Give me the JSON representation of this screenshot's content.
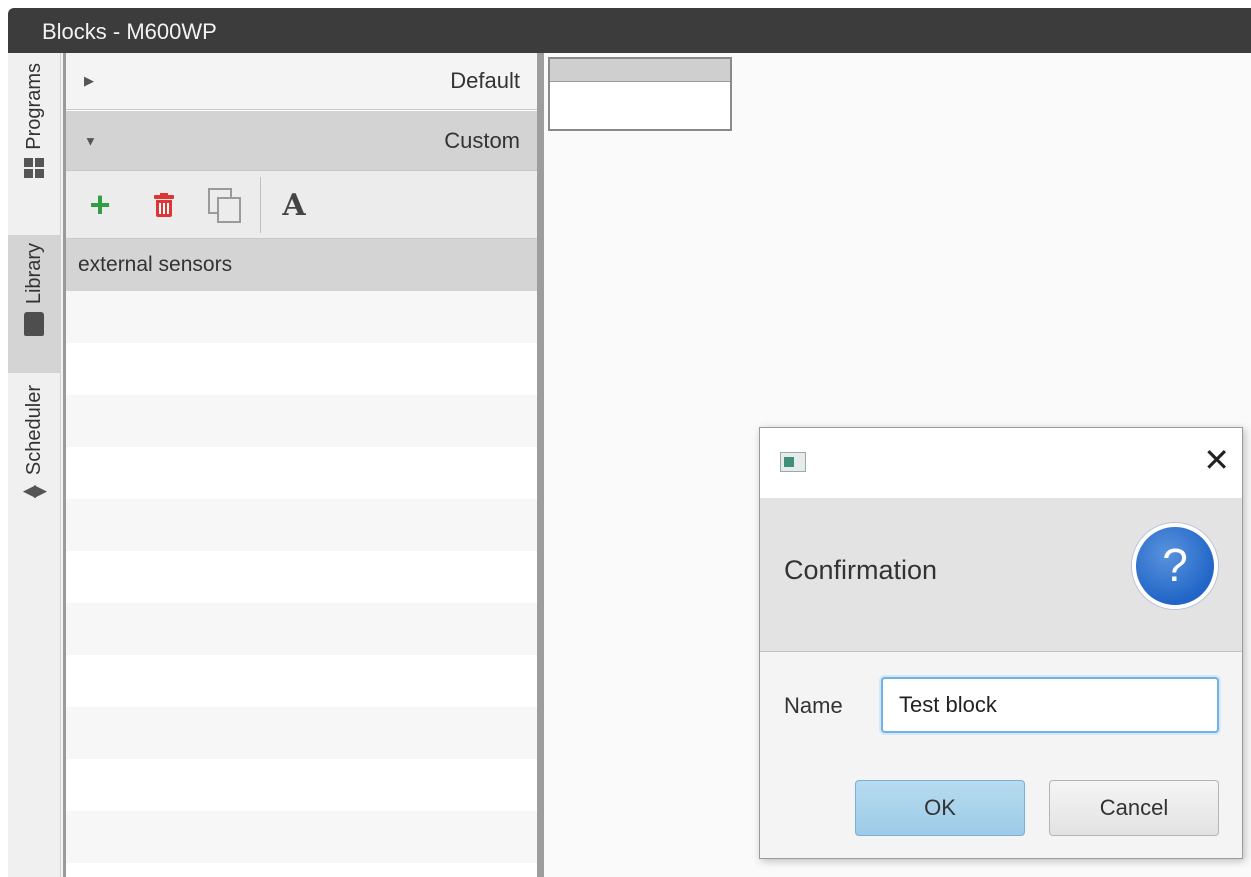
{
  "window": {
    "title": "Blocks - M600WP"
  },
  "side_tabs": [
    {
      "label": "Programs",
      "icon": "grid-icon",
      "selected": false
    },
    {
      "label": "Library",
      "icon": "book-icon",
      "selected": true
    },
    {
      "label": "Scheduler",
      "icon": "left-right-arrows-icon",
      "selected": false
    }
  ],
  "library": {
    "sections": [
      {
        "label": "Default",
        "expanded": false,
        "expander": "▶"
      },
      {
        "label": "Custom",
        "expanded": true,
        "expander": "▼"
      }
    ],
    "toolbar": {
      "add_icon": "+",
      "rename_icon": "A"
    },
    "items": [
      {
        "label": "external sensors",
        "selected": true
      },
      {
        "label": ""
      },
      {
        "label": ""
      },
      {
        "label": ""
      },
      {
        "label": ""
      },
      {
        "label": ""
      },
      {
        "label": ""
      },
      {
        "label": ""
      },
      {
        "label": ""
      },
      {
        "label": ""
      },
      {
        "label": ""
      },
      {
        "label": ""
      },
      {
        "label": ""
      }
    ]
  },
  "dialog": {
    "close_glyph": "✕",
    "title": "Confirmation",
    "question_glyph": "?",
    "name_label": "Name",
    "name_value": "Test block",
    "ok_label": "OK",
    "cancel_label": "Cancel"
  },
  "colors": {
    "titlebar": "#3c3c3c",
    "selected_row": "#d4d4d4",
    "add_green": "#2f9e44",
    "delete_red": "#e03535",
    "question_blue": "#2166c7",
    "ok_button": "#a9d3ec",
    "input_focus": "#6fb2e6"
  }
}
